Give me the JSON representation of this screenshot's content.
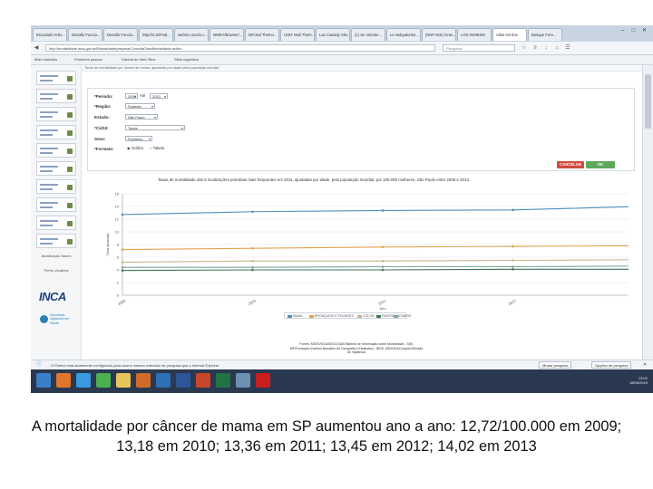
{
  "browser": {
    "tabs": [
      "Escudado Arbo...",
      "Desafio Funcio...",
      "Desafio Funcio...",
      "http://tc.D/Fnal...",
      "webmo.oraclo.c...",
      "MNRA/Bowser/...",
      "DR:stal Themo...",
      "UOIF Mail Thom...",
      "Las Cassidy Sho...",
      "(1) Se orienter...",
      "Le webpaketze...",
      "(DNF-INK) Grav...",
      "LOG INMKMS",
      "Atlas On-line",
      "Bosque Fore..."
    ],
    "window_controls": [
      "–",
      "□",
      "✕"
    ],
    "url": "http://mortalidade.inca.gov.br/Mortalidade/prepararConsultaTaxaMortalidade.action",
    "search_placeholder": "Pesquisar",
    "bookmarks": [
      "Mais visitados",
      "Primeiros passos",
      "Galeria de Web Slice",
      "Sites sugeridos"
    ]
  },
  "sidebar": {
    "label_1": "Atualização Bases",
    "label_2": "Perfis Usuários",
    "logo": "INCA",
    "partner": "Secretaria Vigilância em Saúde"
  },
  "page_top_text": "Taxas de mortalidade por câncer de mama, ajustadas por idade pela população mundial",
  "form": {
    "periodo_label": "*Período:",
    "periodo_de": "2009",
    "periodo_ate_label": "Até",
    "periodo_ate": "2013",
    "regiao_label": "*Região:",
    "regiao_value": "Sudeste",
    "estado_label": "Estado:",
    "estado_value": "São Paulo",
    "cid_label": "*Cid10:",
    "cid_value": "Todos",
    "sexo_label": "Sexo:",
    "sexo_value": "Feminino",
    "formato_label": "*Formato:",
    "formato_options": [
      "Gráfico",
      "Tabela"
    ],
    "cancel_button": "CANCELAR",
    "ok_button": "OK"
  },
  "chart_data": {
    "type": "line",
    "title": "Taxas de mortalidade das 5 localizações primárias mais frequentes em 2011, ajustadas por idade, pela população mundial, por 100.000 mulheres, São Paulo entre 2009 e 2013.",
    "x": [
      "2009",
      "2010",
      "2011",
      "2012",
      "2013"
    ],
    "xlabel": "Ano",
    "ylabel": "Taxa ajustada",
    "ylim": [
      0,
      16
    ],
    "yticks": [
      "0",
      "2",
      "4",
      "6",
      "8",
      "10",
      "12",
      "14",
      "16"
    ],
    "grid": true,
    "legend_position": "bottom",
    "series": [
      {
        "name": "MAMA",
        "color": "#4f90bf",
        "values": [
          12.72,
          13.18,
          13.36,
          13.45,
          14.02
        ]
      },
      {
        "name": "BRONQUIOS E PULMOES",
        "color": "#e3a14e",
        "values": [
          7.2,
          7.4,
          7.6,
          7.7,
          7.8
        ]
      },
      {
        "name": "COLON",
        "color": "#c4b488",
        "values": [
          5.2,
          5.4,
          5.4,
          5.5,
          5.6
        ]
      },
      {
        "name": "PANCREAS",
        "color": "#3e7450",
        "values": [
          3.9,
          4.0,
          4.0,
          4.1,
          4.1
        ]
      },
      {
        "name": "OVARIO",
        "color": "#7fa59b",
        "values": [
          4.4,
          4.4,
          4.5,
          4.5,
          4.6
        ]
      }
    ]
  },
  "source": "Fontes: MS/SVS/DASIS/CGIAE/Sistema de Informação sobre Mortalidade - SIM; MP/Fundação Instituto Brasileiro de Geografia e Estatística - IBGE; MS/INCA/Conprev/Divisão de Vigilância",
  "statusbar": {
    "message": "O Firefox está atualmente configurado para usar a mesma extensão de pesquisa que o Internet Explorer.",
    "button_1": "Opções de pesquisa",
    "button_2": "Mudar pesquisa",
    "close": "✕"
  },
  "taskbar": {
    "apps": [
      {
        "name": "windows-start-icon",
        "color": "#3a7fc8"
      },
      {
        "name": "firefox-icon",
        "color": "#e0762b"
      },
      {
        "name": "ie-icon",
        "color": "#3a9ae0"
      },
      {
        "name": "chrome-icon",
        "color": "#4caf50"
      },
      {
        "name": "folder-icon",
        "color": "#e8c35a"
      },
      {
        "name": "media-icon",
        "color": "#d26a2a"
      },
      {
        "name": "outlook-icon",
        "color": "#2f6fb7"
      },
      {
        "name": "word-icon",
        "color": "#2b579a"
      },
      {
        "name": "powerpoint-icon",
        "color": "#c8472b"
      },
      {
        "name": "excel-icon",
        "color": "#217346"
      },
      {
        "name": "app-icon",
        "color": "#6d8fb0"
      },
      {
        "name": "acrobat-icon",
        "color": "#c81e1e"
      }
    ],
    "time": "13:02",
    "date": "18/06/2015"
  },
  "caption": "A mortalidade por câncer de mama em SP aumentou ano a ano: 12,72/100.000 em 2009; 13,18 em 2010; 13,36 em 2011; 13,45 em 2012; 14,02 em 2013"
}
